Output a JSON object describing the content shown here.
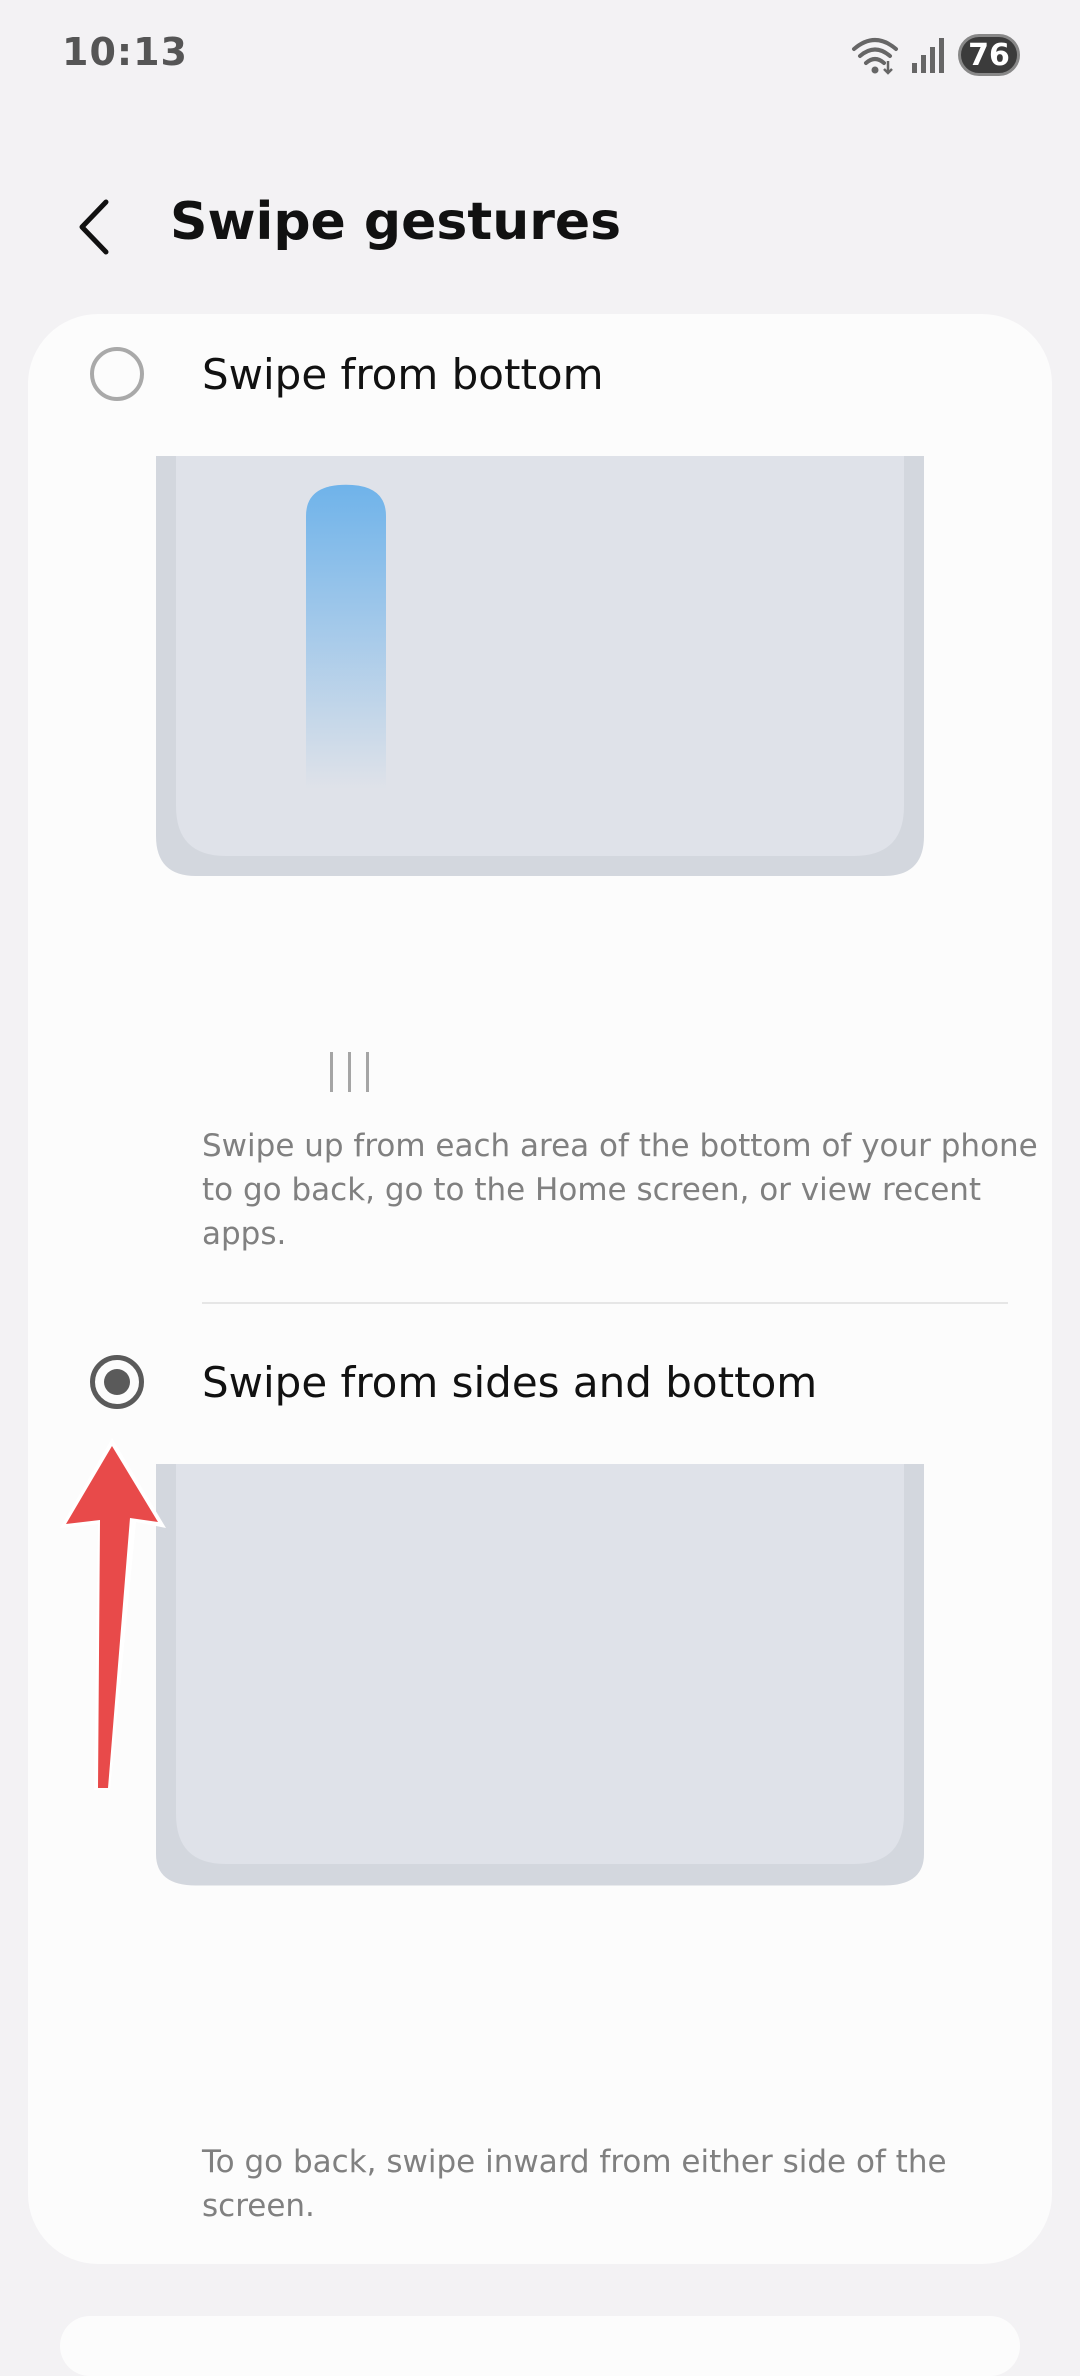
{
  "status_bar": {
    "time": "10:13",
    "battery_level": "76",
    "icons": [
      "wifi-icon",
      "signal-icon",
      "battery-icon"
    ]
  },
  "header": {
    "title": "Swipe gestures",
    "back_icon": "chevron-left-icon"
  },
  "options": [
    {
      "label": "Swipe from bottom",
      "selected": false,
      "description": "Swipe up from each area of the bottom of your phone to go back, go to the Home screen, or view recent apps."
    },
    {
      "label": "Swipe from sides and bottom",
      "selected": true,
      "description": "To go back, swipe inward from either side of the screen."
    }
  ],
  "colors": {
    "background": "#f3f2f4",
    "card": "#fcfcfc",
    "phone_screen": "#dfe2e9",
    "phone_frame": "#d3d7de",
    "swipe_accent": "#6fb3ea",
    "arrow": "#e84a4a"
  }
}
